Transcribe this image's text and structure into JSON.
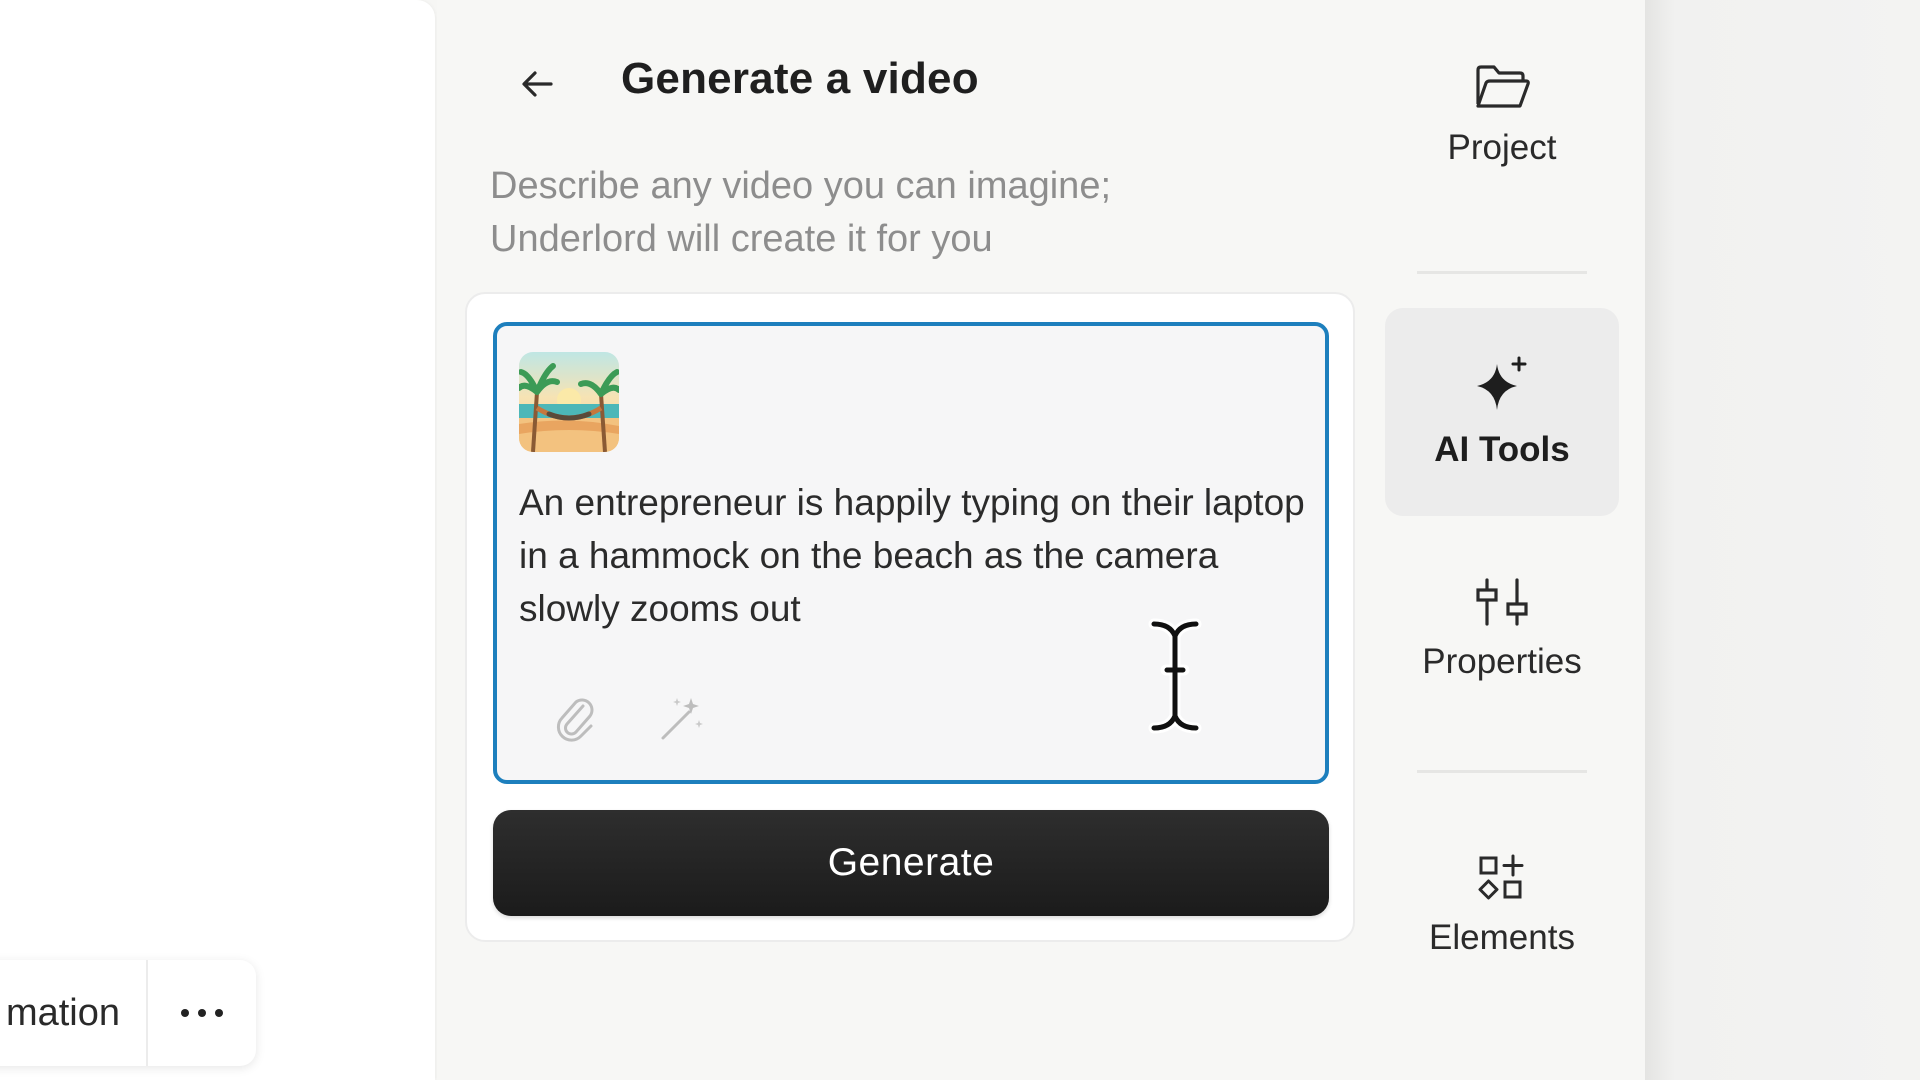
{
  "canvas_toolbar": {
    "label": "mation",
    "more_icon": "more-horizontal-icon"
  },
  "panel": {
    "back_icon": "arrow-left-icon",
    "title": "Generate a video",
    "subtitle_line1": "Describe any video you can imagine;",
    "subtitle_line2": "Underlord will create it for you",
    "attachment_icon": "beach-hammock-thumbnail",
    "prompt": "An entrepreneur is happily typing on their laptop in a hammock on the beach as the camera slowly zooms out",
    "attach_icon": "paperclip-icon",
    "magic_icon": "magic-wand-icon",
    "generate_label": "Generate"
  },
  "rail": {
    "items": [
      {
        "label": "Project",
        "icon": "folder-icon",
        "active": false
      },
      {
        "label": "AI Tools",
        "icon": "sparkle-icon",
        "active": true
      },
      {
        "label": "Properties",
        "icon": "sliders-icon",
        "active": false
      },
      {
        "label": "Elements",
        "icon": "shapes-icon",
        "active": false
      }
    ]
  },
  "colors": {
    "focus_border": "#1d7fbd",
    "generate_bg": "#222222",
    "active_rail_bg": "#ececec"
  }
}
